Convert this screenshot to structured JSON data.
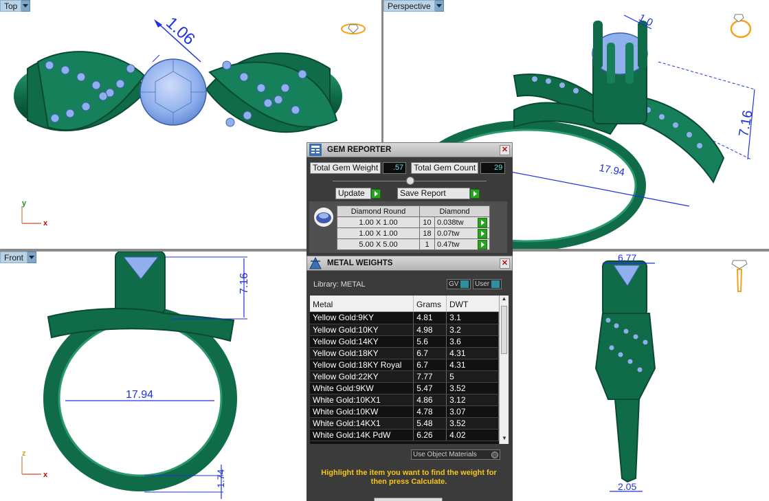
{
  "viewports": {
    "top": {
      "label": "Top",
      "dim": "1.06",
      "axis_v": "y",
      "axis_h": "x"
    },
    "perspective": {
      "label": "Perspective",
      "dims": [
        "1.0",
        "7.16",
        "17.94"
      ]
    },
    "front": {
      "label": "Front",
      "dims": [
        "7.16",
        "17.94",
        "1.74"
      ],
      "axis_v": "z",
      "axis_h": "x"
    },
    "right": {
      "dims": [
        "6.77",
        "2.05"
      ]
    }
  },
  "gem_reporter": {
    "title": "GEM REPORTER",
    "total_weight_label": "Total Gem Weight",
    "total_weight_value": ".57",
    "total_count_label": "Total Gem Count",
    "total_count_value": "29",
    "update_label": "Update",
    "save_report_label": "Save Report",
    "columns": [
      "Diamond Round",
      "Diamond"
    ],
    "rows": [
      {
        "size": "1.00 X 1.00",
        "count": "10",
        "weight": "0.038tw"
      },
      {
        "size": "1.00 X 1.00",
        "count": "18",
        "weight": "0.07tw"
      },
      {
        "size": "5.00 X 5.00",
        "count": "1",
        "weight": "0.47tw"
      }
    ]
  },
  "metal_weights": {
    "title": "METAL WEIGHTS",
    "library_label": "Library: METAL",
    "gv_label": "GV",
    "user_label": "User",
    "columns": [
      "Metal",
      "Grams",
      "DWT"
    ],
    "rows": [
      {
        "metal": "Yellow Gold:9KY",
        "grams": "4.81",
        "dwt": "3.1"
      },
      {
        "metal": "Yellow Gold:10KY",
        "grams": "4.98",
        "dwt": "3.2"
      },
      {
        "metal": "Yellow Gold:14KY",
        "grams": "5.6",
        "dwt": "3.6"
      },
      {
        "metal": "Yellow Gold:18KY",
        "grams": "6.7",
        "dwt": "4.31"
      },
      {
        "metal": "Yellow Gold:18KY Royal",
        "grams": "6.7",
        "dwt": "4.31"
      },
      {
        "metal": "Yellow Gold:22KY",
        "grams": "7.77",
        "dwt": "5"
      },
      {
        "metal": "White Gold:9KW",
        "grams": "5.47",
        "dwt": "3.52"
      },
      {
        "metal": "White Gold:10KX1",
        "grams": "4.86",
        "dwt": "3.12"
      },
      {
        "metal": "White Gold:10KW",
        "grams": "4.78",
        "dwt": "3.07"
      },
      {
        "metal": "White Gold:14KX1",
        "grams": "5.48",
        "dwt": "3.52"
      },
      {
        "metal": "White Gold:14K PdW",
        "grams": "6.26",
        "dwt": "4.02"
      }
    ],
    "use_object_materials_label": "Use Object Materials",
    "hint": "Highlight the item you want to find the weight for then press Calculate."
  },
  "colors": {
    "metal": "#0f6b48",
    "gem": "#8fb0ec",
    "dim": "#1e32e0"
  }
}
